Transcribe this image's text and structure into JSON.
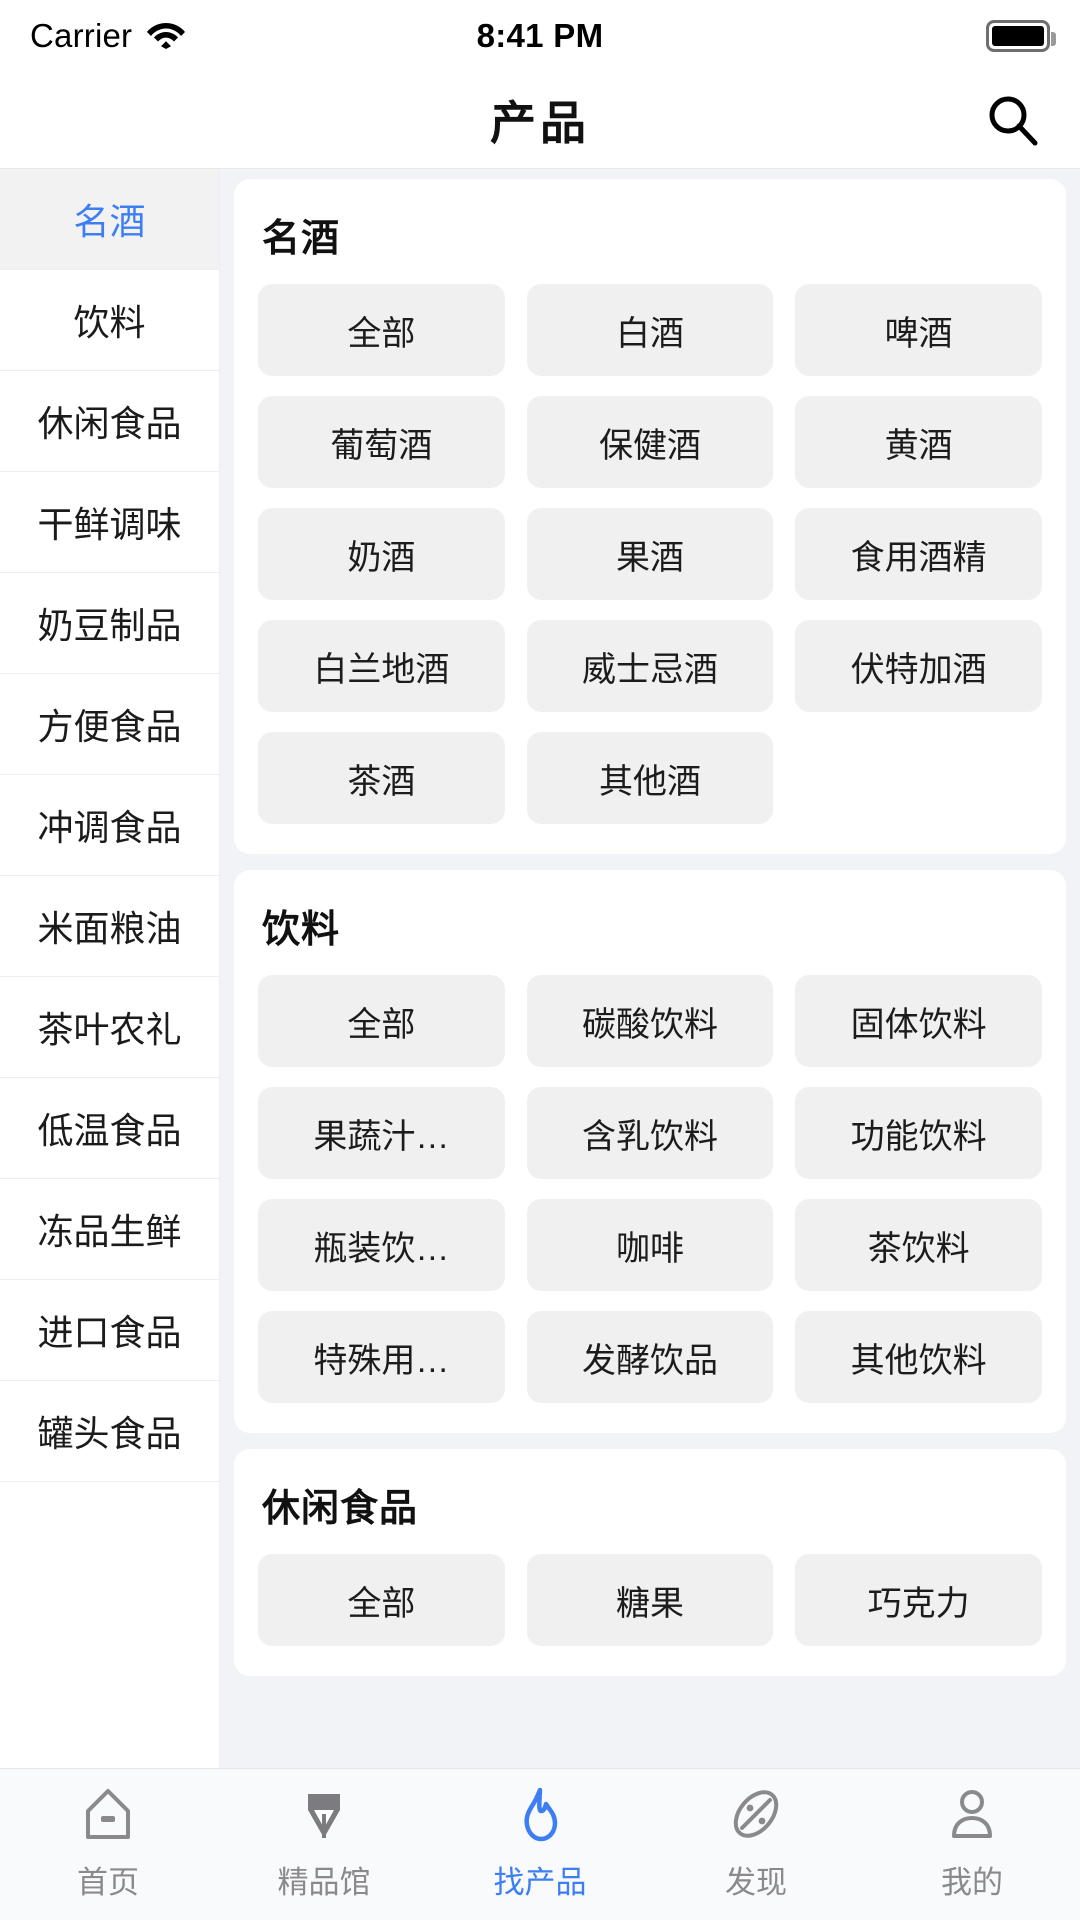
{
  "status_bar": {
    "carrier": "Carrier",
    "time": "8:41 PM",
    "wifi_icon": "wifi-icon",
    "battery_icon": "battery-icon"
  },
  "nav": {
    "title": "产品",
    "search_icon": "search-icon"
  },
  "sidebar": {
    "items": [
      {
        "label": "名酒",
        "active": true
      },
      {
        "label": "饮料",
        "active": false
      },
      {
        "label": "休闲食品",
        "active": false
      },
      {
        "label": "干鲜调味",
        "active": false
      },
      {
        "label": "奶豆制品",
        "active": false
      },
      {
        "label": "方便食品",
        "active": false
      },
      {
        "label": "冲调食品",
        "active": false
      },
      {
        "label": "米面粮油",
        "active": false
      },
      {
        "label": "茶叶农礼",
        "active": false
      },
      {
        "label": "低温食品",
        "active": false
      },
      {
        "label": "冻品生鲜",
        "active": false
      },
      {
        "label": "进口食品",
        "active": false
      },
      {
        "label": "罐头食品",
        "active": false
      }
    ]
  },
  "content": {
    "sections": [
      {
        "title": "名酒",
        "tags": [
          "全部",
          "白酒",
          "啤酒",
          "葡萄酒",
          "保健酒",
          "黄酒",
          "奶酒",
          "果酒",
          "食用酒精",
          "白兰地酒",
          "威士忌酒",
          "伏特加酒",
          "茶酒",
          "其他酒"
        ]
      },
      {
        "title": "饮料",
        "tags": [
          "全部",
          "碳酸饮料",
          "固体饮料",
          "果蔬汁…",
          "含乳饮料",
          "功能饮料",
          "瓶装饮…",
          "咖啡",
          "茶饮料",
          "特殊用…",
          "发酵饮品",
          "其他饮料"
        ]
      },
      {
        "title": "休闲食品",
        "tags": [
          "全部",
          "糖果",
          "巧克力"
        ]
      }
    ]
  },
  "tabbar": {
    "tabs": [
      {
        "label": "首页",
        "icon": "home-icon",
        "active": false
      },
      {
        "label": "精品馆",
        "icon": "pen-nib-icon",
        "active": false
      },
      {
        "label": "找产品",
        "icon": "flame-icon",
        "active": true
      },
      {
        "label": "发现",
        "icon": "compass-icon",
        "active": false
      },
      {
        "label": "我的",
        "icon": "person-icon",
        "active": false
      }
    ]
  },
  "colors": {
    "accent": "#3d7ef4",
    "page_bg": "#f1f3f7",
    "card_bg": "#ffffff",
    "tag_bg": "#f0f0f1",
    "inactive_text": "#8a8a8e"
  }
}
